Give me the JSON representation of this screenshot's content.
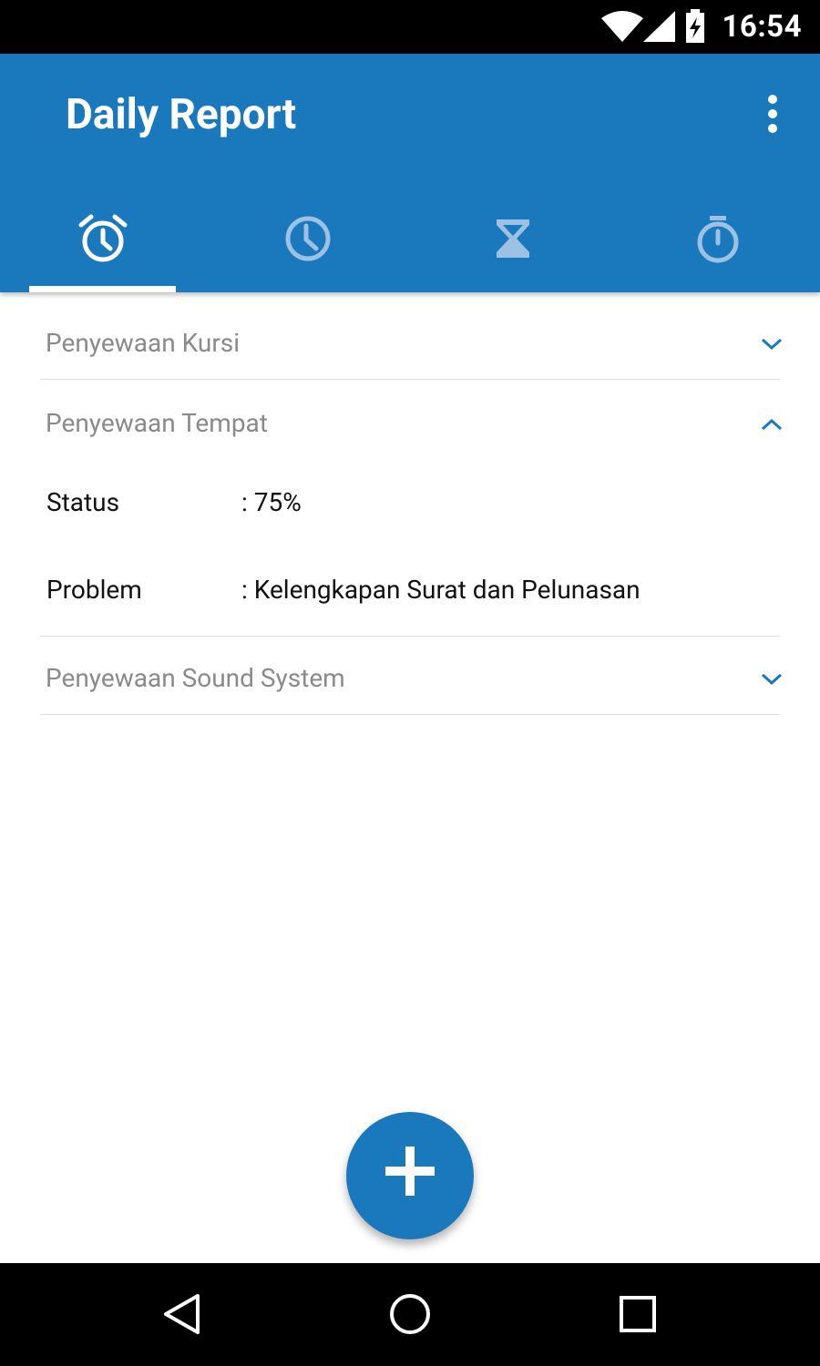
{
  "status_bar": {
    "time": "16:54",
    "icons": [
      "wifi-icon",
      "signal-icon",
      "battery-charging-icon"
    ]
  },
  "app_bar": {
    "title": "Daily Report",
    "menu_icon": "more-vert-icon",
    "background": "#1a78bd"
  },
  "tabs": [
    {
      "icon": "alarm-clock-icon",
      "active": true
    },
    {
      "icon": "clock-icon",
      "active": false
    },
    {
      "icon": "hourglass-icon",
      "active": false
    },
    {
      "icon": "stopwatch-icon",
      "active": false
    }
  ],
  "sections": [
    {
      "title": "Penyewaan Kursi",
      "expanded": false
    },
    {
      "title": "Penyewaan Tempat",
      "expanded": true,
      "fields": [
        {
          "label": "Status",
          "value": ": 75%"
        },
        {
          "label": "Problem",
          "value": ": Kelengkapan Surat dan Pelunasan"
        }
      ]
    },
    {
      "title": "Penyewaan Sound System",
      "expanded": false
    }
  ],
  "fab": {
    "icon": "plus-icon"
  },
  "nav_bar": {
    "icons": [
      "back-icon",
      "home-icon",
      "recents-icon"
    ]
  }
}
